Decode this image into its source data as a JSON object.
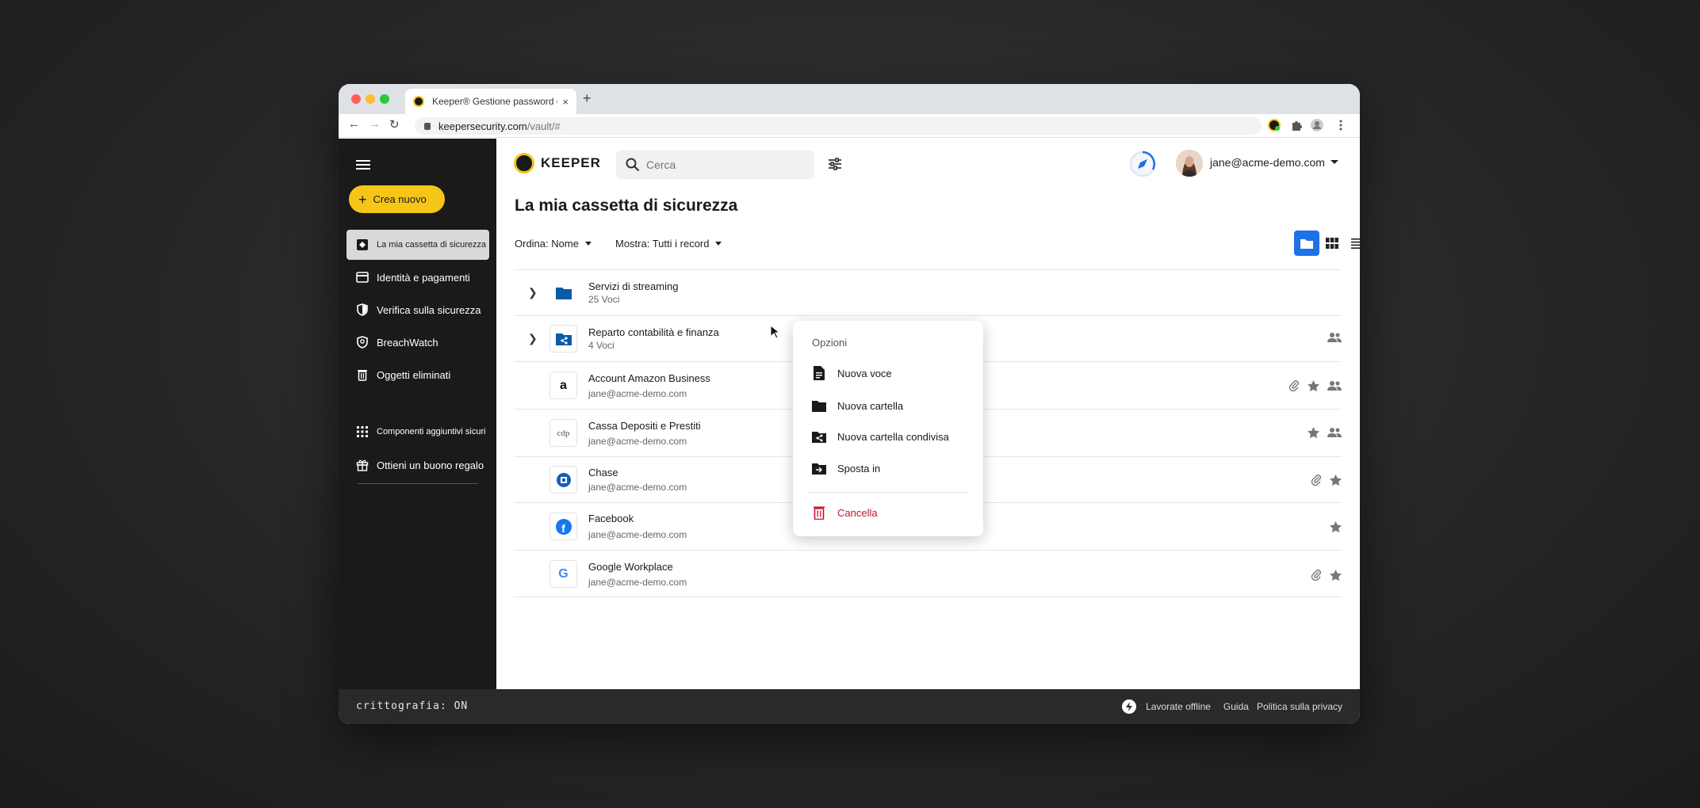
{
  "browser": {
    "tab_title": "Keeper® Gestione password e",
    "tab_close": "×",
    "new_tab": "+",
    "url_host": "keepersecurity.com",
    "url_path": "/vault/#"
  },
  "sidebar": {
    "create_label": "Crea nuovo",
    "items": [
      {
        "label": "La mia cassetta di sicurezza",
        "icon": "vault-icon"
      },
      {
        "label": "Identità e pagamenti",
        "icon": "card-icon"
      },
      {
        "label": "Verifica sulla sicurezza",
        "icon": "shield-icon"
      },
      {
        "label": "BreachWatch",
        "icon": "breachwatch-icon"
      },
      {
        "label": "Oggetti eliminati",
        "icon": "trash-icon"
      }
    ],
    "extras": [
      {
        "label": "Componenti aggiuntivi sicuri",
        "icon": "grid-icon"
      },
      {
        "label": "Ottieni un buono regalo",
        "icon": "gift-icon"
      }
    ]
  },
  "header": {
    "logo_text": "KEEPER",
    "search_placeholder": "Cerca",
    "user_email": "jane@acme-demo.com"
  },
  "main": {
    "title": "La mia cassetta di sicurezza",
    "sort_label": "Ordina: Nome",
    "show_label": "Mostra: Tutti i record"
  },
  "records": [
    {
      "name": "Servizi di streaming",
      "sub": "25 Voci",
      "kind": "folder"
    },
    {
      "name": "Reparto contabilità e finanza",
      "sub": "4 Voci",
      "kind": "shared-folder"
    },
    {
      "name": "Account Amazon Business",
      "sub": "jane@acme-demo.com",
      "kind": "amazon"
    },
    {
      "name": "Cassa Depositi e Prestiti",
      "sub": "jane@acme-demo.com",
      "kind": "cdp"
    },
    {
      "name": "Chase",
      "sub": "jane@acme-demo.com",
      "kind": "chase"
    },
    {
      "name": "Facebook",
      "sub": "jane@acme-demo.com",
      "kind": "facebook"
    },
    {
      "name": "Google Workplace",
      "sub": "jane@acme-demo.com",
      "kind": "google"
    }
  ],
  "icon_text": {
    "amazon": "a",
    "cdp": "cdp",
    "google": "G",
    "facebook": "f"
  },
  "context_menu": {
    "header": "Opzioni",
    "items": [
      "Nuova voce",
      "Nuova cartella",
      "Nuova cartella condivisa",
      "Sposta in"
    ],
    "delete": "Cancella"
  },
  "footer": {
    "crypto": "crittografia: ON",
    "offline": "Lavorate offline",
    "guide": "Guida",
    "privacy": "Politica sulla privacy"
  },
  "colors": {
    "accent_yellow": "#f5c518",
    "accent_blue": "#1d72e8",
    "danger": "#c4122f",
    "sidebar_bg": "#1a1a1a"
  }
}
